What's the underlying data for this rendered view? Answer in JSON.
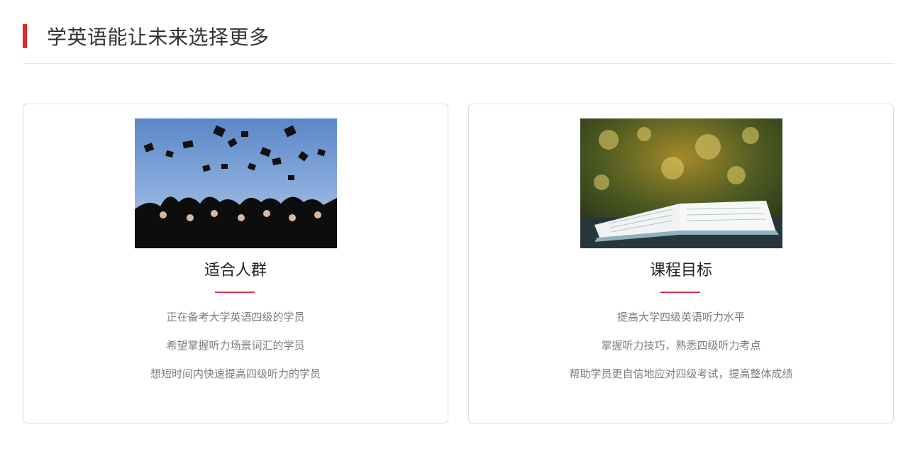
{
  "section": {
    "title": "学英语能让未来选择更多",
    "accent_color": "#e02a2a"
  },
  "cards": [
    {
      "image_icon": "graduation-caps-photo",
      "title": "适合人群",
      "items": [
        "正在备考大学英语四级的学员",
        "希望掌握听力场景词汇的学员",
        "想短时间内快速提高四级听力的学员"
      ]
    },
    {
      "image_icon": "open-book-photo",
      "title": "课程目标",
      "items": [
        "提高大学四级英语听力水平",
        "掌握听力技巧，熟悉四级听力考点",
        "帮助学员更自信地应对四级考试，提高整体成绩"
      ]
    }
  ],
  "divider_color": "#e0314b"
}
